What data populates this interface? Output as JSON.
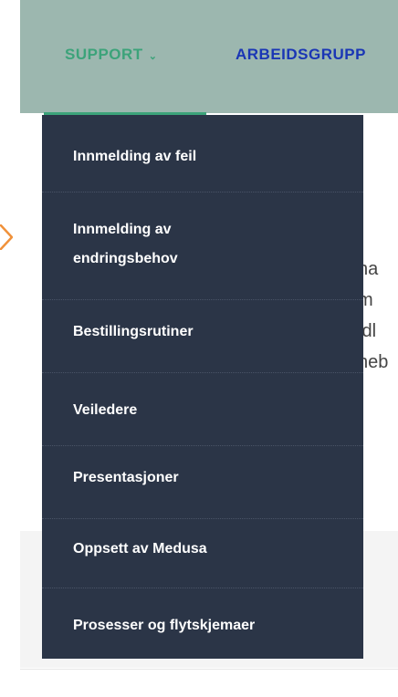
{
  "nav": {
    "support_label": "SUPPORT",
    "support_chevron": "⌄",
    "arbeidsgrupper_label": "ARBEIDSGRUPP"
  },
  "dropdown": {
    "items": [
      {
        "label": "Innmelding av feil"
      },
      {
        "label": "Innmelding av\nendringsbehov"
      },
      {
        "label": "Bestillingsrutiner"
      },
      {
        "label": "Veiledere"
      },
      {
        "label": "Presentasjoner"
      },
      {
        "label": "Oppsett av Medusa"
      },
      {
        "label": "Prosesser og flytskjemaer"
      }
    ]
  },
  "background_text": [
    "na",
    "m",
    "idl",
    "neb"
  ],
  "colors": {
    "header": "#9cb7af",
    "support_green": "#3ca37a",
    "arbeid_blue": "#1a36b5",
    "menu_bg": "#2b3547",
    "arrow_orange": "#f0913a"
  }
}
